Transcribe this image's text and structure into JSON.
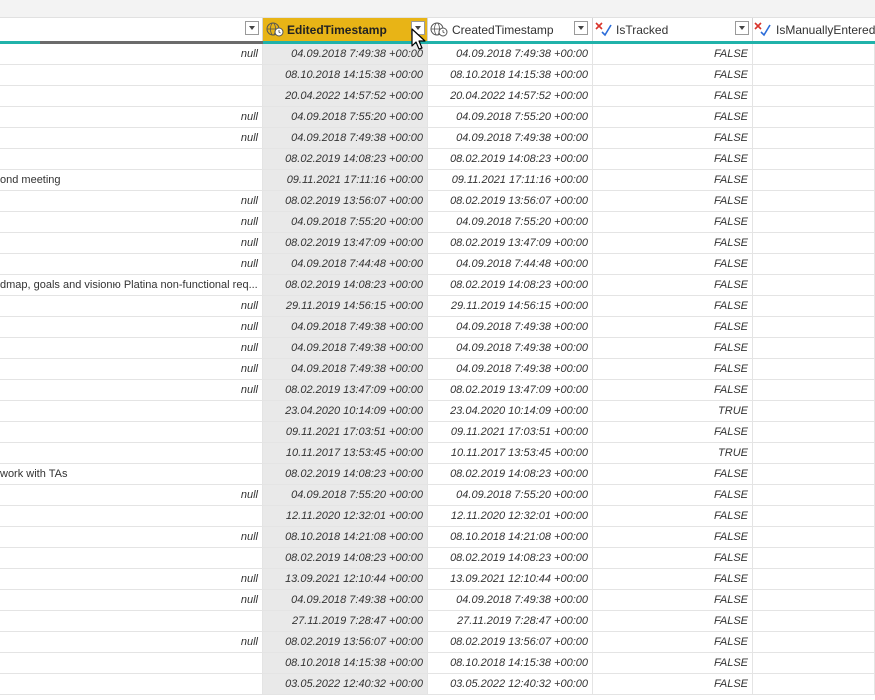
{
  "header": {
    "columns": [
      {
        "name": "EditedTimestamp",
        "type_icon": "globe-clock-icon"
      },
      {
        "name": "CreatedTimestamp",
        "type_icon": "globe-clock-icon"
      },
      {
        "name": "IsTracked",
        "type_icon": "boolean-icon"
      },
      {
        "name": "IsManuallyEntered",
        "type_icon": "boolean-icon"
      }
    ]
  },
  "colors": {
    "selected_header": "#e8b416",
    "quality_bar": "#20b2aa",
    "selected_column": "#e9e9e9"
  },
  "rows": [
    {
      "title": "",
      "null": "null",
      "edited": "04.09.2018 7:49:38 +00:00",
      "created": "04.09.2018 7:49:38 +00:00",
      "tracked": "FALSE"
    },
    {
      "title": "",
      "null": "",
      "edited": "08.10.2018 14:15:38 +00:00",
      "created": "08.10.2018 14:15:38 +00:00",
      "tracked": "FALSE"
    },
    {
      "title": "",
      "null": "",
      "edited": "20.04.2022 14:57:52 +00:00",
      "created": "20.04.2022 14:57:52 +00:00",
      "tracked": "FALSE"
    },
    {
      "title": "",
      "null": "null",
      "edited": "04.09.2018 7:55:20 +00:00",
      "created": "04.09.2018 7:55:20 +00:00",
      "tracked": "FALSE"
    },
    {
      "title": "",
      "null": "null",
      "edited": "04.09.2018 7:49:38 +00:00",
      "created": "04.09.2018 7:49:38 +00:00",
      "tracked": "FALSE"
    },
    {
      "title": "",
      "null": "",
      "edited": "08.02.2019 14:08:23 +00:00",
      "created": "08.02.2019 14:08:23 +00:00",
      "tracked": "FALSE"
    },
    {
      "title": "ond meeting",
      "null": "",
      "edited": "09.11.2021 17:11:16 +00:00",
      "created": "09.11.2021 17:11:16 +00:00",
      "tracked": "FALSE"
    },
    {
      "title": "",
      "null": "null",
      "edited": "08.02.2019 13:56:07 +00:00",
      "created": "08.02.2019 13:56:07 +00:00",
      "tracked": "FALSE"
    },
    {
      "title": "",
      "null": "null",
      "edited": "04.09.2018 7:55:20 +00:00",
      "created": "04.09.2018 7:55:20 +00:00",
      "tracked": "FALSE"
    },
    {
      "title": "",
      "null": "null",
      "edited": "08.02.2019 13:47:09 +00:00",
      "created": "08.02.2019 13:47:09 +00:00",
      "tracked": "FALSE"
    },
    {
      "title": "",
      "null": "null",
      "edited": "04.09.2018 7:44:48 +00:00",
      "created": "04.09.2018 7:44:48 +00:00",
      "tracked": "FALSE"
    },
    {
      "title": "dmap, goals and visionю Platina non-functional req...",
      "null": "",
      "edited": "08.02.2019 14:08:23 +00:00",
      "created": "08.02.2019 14:08:23 +00:00",
      "tracked": "FALSE"
    },
    {
      "title": "",
      "null": "null",
      "edited": "29.11.2019 14:56:15 +00:00",
      "created": "29.11.2019 14:56:15 +00:00",
      "tracked": "FALSE"
    },
    {
      "title": "",
      "null": "null",
      "edited": "04.09.2018 7:49:38 +00:00",
      "created": "04.09.2018 7:49:38 +00:00",
      "tracked": "FALSE"
    },
    {
      "title": "",
      "null": "null",
      "edited": "04.09.2018 7:49:38 +00:00",
      "created": "04.09.2018 7:49:38 +00:00",
      "tracked": "FALSE"
    },
    {
      "title": "",
      "null": "null",
      "edited": "04.09.2018 7:49:38 +00:00",
      "created": "04.09.2018 7:49:38 +00:00",
      "tracked": "FALSE"
    },
    {
      "title": "",
      "null": "null",
      "edited": "08.02.2019 13:47:09 +00:00",
      "created": "08.02.2019 13:47:09 +00:00",
      "tracked": "FALSE"
    },
    {
      "title": "",
      "null": "",
      "edited": "23.04.2020 10:14:09 +00:00",
      "created": "23.04.2020 10:14:09 +00:00",
      "tracked": "TRUE"
    },
    {
      "title": "",
      "null": "",
      "edited": "09.11.2021 17:03:51 +00:00",
      "created": "09.11.2021 17:03:51 +00:00",
      "tracked": "FALSE"
    },
    {
      "title": "",
      "null": "",
      "edited": "10.11.2017 13:53:45 +00:00",
      "created": "10.11.2017 13:53:45 +00:00",
      "tracked": "TRUE"
    },
    {
      "title": "work with TAs",
      "null": "",
      "edited": "08.02.2019 14:08:23 +00:00",
      "created": "08.02.2019 14:08:23 +00:00",
      "tracked": "FALSE"
    },
    {
      "title": "",
      "null": "null",
      "edited": "04.09.2018 7:55:20 +00:00",
      "created": "04.09.2018 7:55:20 +00:00",
      "tracked": "FALSE"
    },
    {
      "title": "",
      "null": "",
      "edited": "12.11.2020 12:32:01 +00:00",
      "created": "12.11.2020 12:32:01 +00:00",
      "tracked": "FALSE"
    },
    {
      "title": "",
      "null": "null",
      "edited": "08.10.2018 14:21:08 +00:00",
      "created": "08.10.2018 14:21:08 +00:00",
      "tracked": "FALSE"
    },
    {
      "title": "",
      "null": "",
      "edited": "08.02.2019 14:08:23 +00:00",
      "created": "08.02.2019 14:08:23 +00:00",
      "tracked": "FALSE"
    },
    {
      "title": "",
      "null": "null",
      "edited": "13.09.2021 12:10:44 +00:00",
      "created": "13.09.2021 12:10:44 +00:00",
      "tracked": "FALSE"
    },
    {
      "title": "",
      "null": "null",
      "edited": "04.09.2018 7:49:38 +00:00",
      "created": "04.09.2018 7:49:38 +00:00",
      "tracked": "FALSE"
    },
    {
      "title": "",
      "null": "",
      "edited": "27.11.2019 7:28:47 +00:00",
      "created": "27.11.2019 7:28:47 +00:00",
      "tracked": "FALSE"
    },
    {
      "title": "",
      "null": "null",
      "edited": "08.02.2019 13:56:07 +00:00",
      "created": "08.02.2019 13:56:07 +00:00",
      "tracked": "FALSE"
    },
    {
      "title": "",
      "null": "",
      "edited": "08.10.2018 14:15:38 +00:00",
      "created": "08.10.2018 14:15:38 +00:00",
      "tracked": "FALSE"
    },
    {
      "title": "",
      "null": "",
      "edited": "03.05.2022 12:40:32 +00:00",
      "created": "03.05.2022 12:40:32 +00:00",
      "tracked": "FALSE"
    }
  ]
}
